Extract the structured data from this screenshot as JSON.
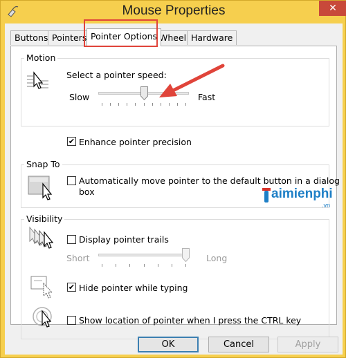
{
  "window": {
    "title": "Mouse Properties",
    "close_glyph": "✕",
    "title_icon": "mouse-icon"
  },
  "tabs": [
    {
      "label": "Buttons"
    },
    {
      "label": "Pointers"
    },
    {
      "label": "Pointer Options",
      "active": true
    },
    {
      "label": "Wheel"
    },
    {
      "label": "Hardware"
    }
  ],
  "motion": {
    "group_label": "Motion",
    "speed_label": "Select a pointer speed:",
    "slow_label": "Slow",
    "fast_label": "Fast",
    "speed_value": 6,
    "speed_max": 11,
    "precision_label": "Enhance pointer precision",
    "precision_checked": true
  },
  "snap_to": {
    "group_label": "Snap To",
    "auto_label_line1": "Automatically move pointer to the default button in a dialog",
    "auto_label_line2": "box",
    "auto_checked": false
  },
  "visibility": {
    "group_label": "Visibility",
    "trails_label": "Display pointer trails",
    "trails_checked": false,
    "short_label": "Short",
    "long_label": "Long",
    "trail_value": 1.0,
    "hide_label": "Hide pointer while typing",
    "hide_checked": true,
    "ctrl_label": "Show location of pointer when I press the CTRL key",
    "ctrl_checked": false
  },
  "buttons": {
    "ok": "OK",
    "cancel": "Cancel",
    "apply": "Apply"
  },
  "watermark": {
    "brand_main": "aimienphi",
    "brand_suffix": ".vn"
  },
  "colors": {
    "title_bar": "#f6cf4e",
    "highlight": "#e0443a",
    "arrow": "#e0443a",
    "close_button": "#c8493a",
    "watermark_blue": "#1e7fc6",
    "watermark_red": "#d9332b"
  }
}
